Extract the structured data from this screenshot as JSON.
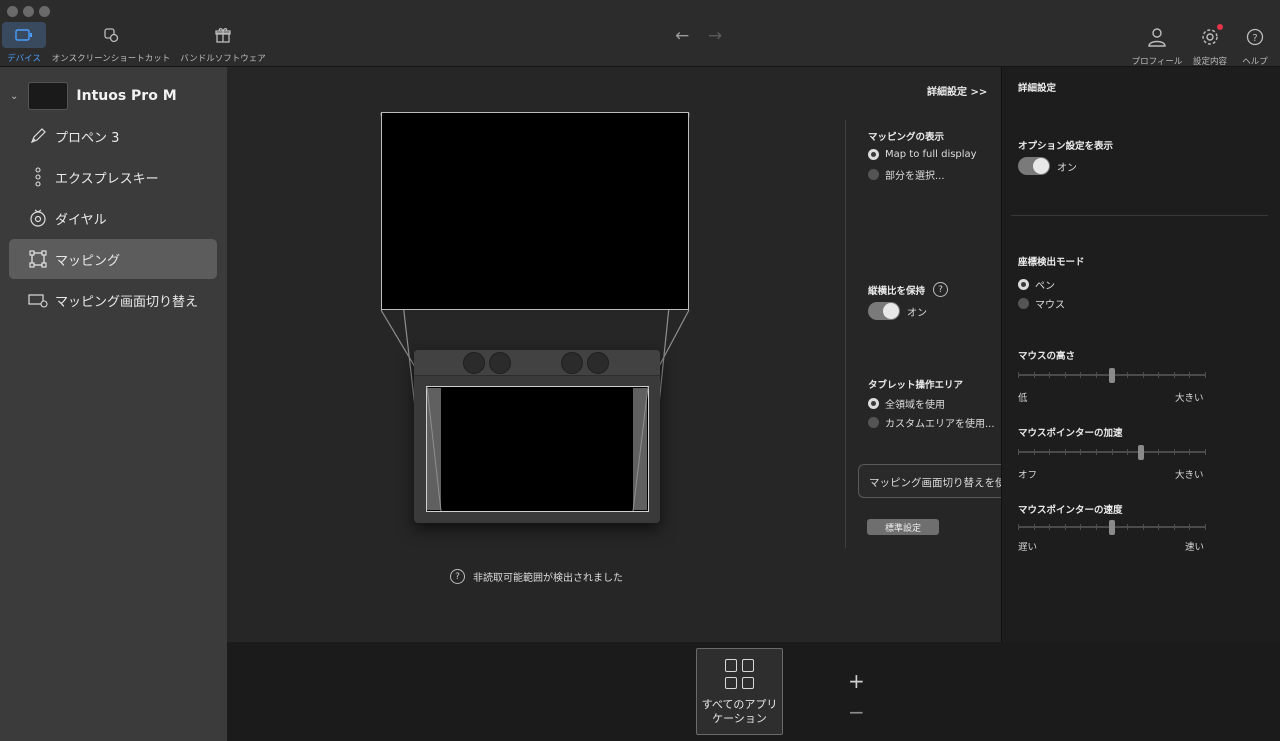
{
  "toolbar": {
    "tabs": [
      {
        "label": "デバイス",
        "icon": "device-icon",
        "active": true
      },
      {
        "label": "オンスクリーンショートカット",
        "icon": "onscreen-shortcut-icon"
      },
      {
        "label": "バンドルソフトウェア",
        "icon": "gift-icon"
      }
    ],
    "right": [
      {
        "label": "プロフィール",
        "icon": "profile-icon"
      },
      {
        "label": "設定内容",
        "icon": "settings-gear-icon"
      },
      {
        "label": "ヘルプ",
        "icon": "help-icon"
      }
    ],
    "back_arrow": "←",
    "forward_arrow": "→"
  },
  "sidebar": {
    "device_name": "Intuos Pro M",
    "items": [
      {
        "label": "プロペン 3",
        "icon": "pen-icon"
      },
      {
        "label": "エクスプレスキー",
        "icon": "express-keys-icon"
      },
      {
        "label": "ダイヤル",
        "icon": "dial-icon"
      },
      {
        "label": "マッピング",
        "icon": "mapping-icon",
        "selected": true
      },
      {
        "label": "マッピング画面切り替え",
        "icon": "display-toggle-icon"
      }
    ]
  },
  "main": {
    "advanced_link": "詳細設定 >>",
    "warning": "非読取可能範囲が検出されました",
    "mapping_display": {
      "title": "マッピングの表示",
      "options": [
        "Map to full display",
        "部分を選択..."
      ],
      "selected": 0
    },
    "aspect": {
      "title": "縦横比を保持",
      "toggle_label": "オン",
      "help": "?"
    },
    "tablet_area": {
      "title": "タブレット操作エリア",
      "options": [
        "全領域を使用",
        "カスタムエリアを使用..."
      ],
      "selected": 0
    },
    "switch_button": "マッピング画面切り替えを使",
    "default_button": "標準設定"
  },
  "right_panel": {
    "title": "詳細設定",
    "show_options": {
      "title": "オプション設定を表示",
      "toggle_label": "オン"
    },
    "coord_mode": {
      "title": "座標検出モード",
      "options": [
        "ペン",
        "マウス"
      ],
      "selected": 0
    },
    "mouse_height": {
      "title": "マウスの高さ",
      "min": "低",
      "max": "大きい",
      "value": 0.5
    },
    "pointer_accel": {
      "title": "マウスポインターの加速",
      "min": "オフ",
      "max": "大きい",
      "value": 0.66
    },
    "pointer_speed": {
      "title": "マウスポインターの速度",
      "min": "遅い",
      "max": "速い",
      "value": 0.5
    }
  },
  "bottom": {
    "app_tile_line1": "すべてのアプリ",
    "app_tile_line2": "ケーション",
    "plus": "+",
    "minus": "−"
  }
}
